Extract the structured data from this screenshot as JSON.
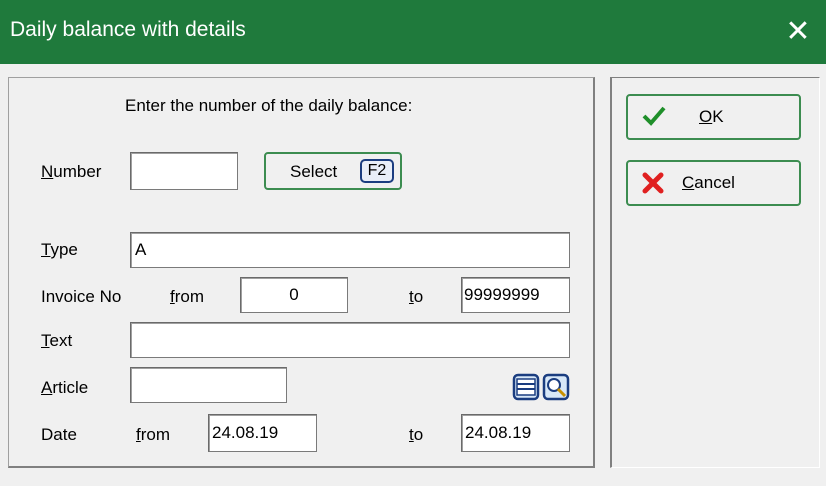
{
  "window": {
    "title": "Daily balance with details",
    "close_glyph": "✕"
  },
  "prompt": "Enter the number of the daily balance:",
  "number": {
    "label_first": "N",
    "label_rest": "umber",
    "value": ""
  },
  "select_button": {
    "label": "Select",
    "key": "F2"
  },
  "type": {
    "label_first": "T",
    "label_rest": "ype",
    "value": "A"
  },
  "invoice": {
    "label": "Invoice No",
    "from_first": "f",
    "from_rest": "rom",
    "from_value": "0",
    "to_first": "t",
    "to_rest": "o",
    "to_value": "99999999"
  },
  "text": {
    "label_first": "T",
    "label_rest": "ext",
    "value": ""
  },
  "article": {
    "label_first": "A",
    "label_rest": "rticle",
    "value": ""
  },
  "date": {
    "label": "Date",
    "from_first": "f",
    "from_rest": "rom",
    "from_value": "24.08.19",
    "to_first": "t",
    "to_rest": "o",
    "to_value": "24.08.19"
  },
  "ok_button": {
    "label_first": "O",
    "label_rest": "K"
  },
  "cancel_button": {
    "label_first": "C",
    "label_rest": "ancel"
  },
  "icons": {
    "list": "list-icon",
    "search": "search-icon",
    "check": "check-icon",
    "cross": "cross-icon"
  },
  "colors": {
    "titlebar": "#1f7a3c",
    "button_border": "#3c8c50",
    "check": "#1f8f2a",
    "cross": "#e02020"
  }
}
